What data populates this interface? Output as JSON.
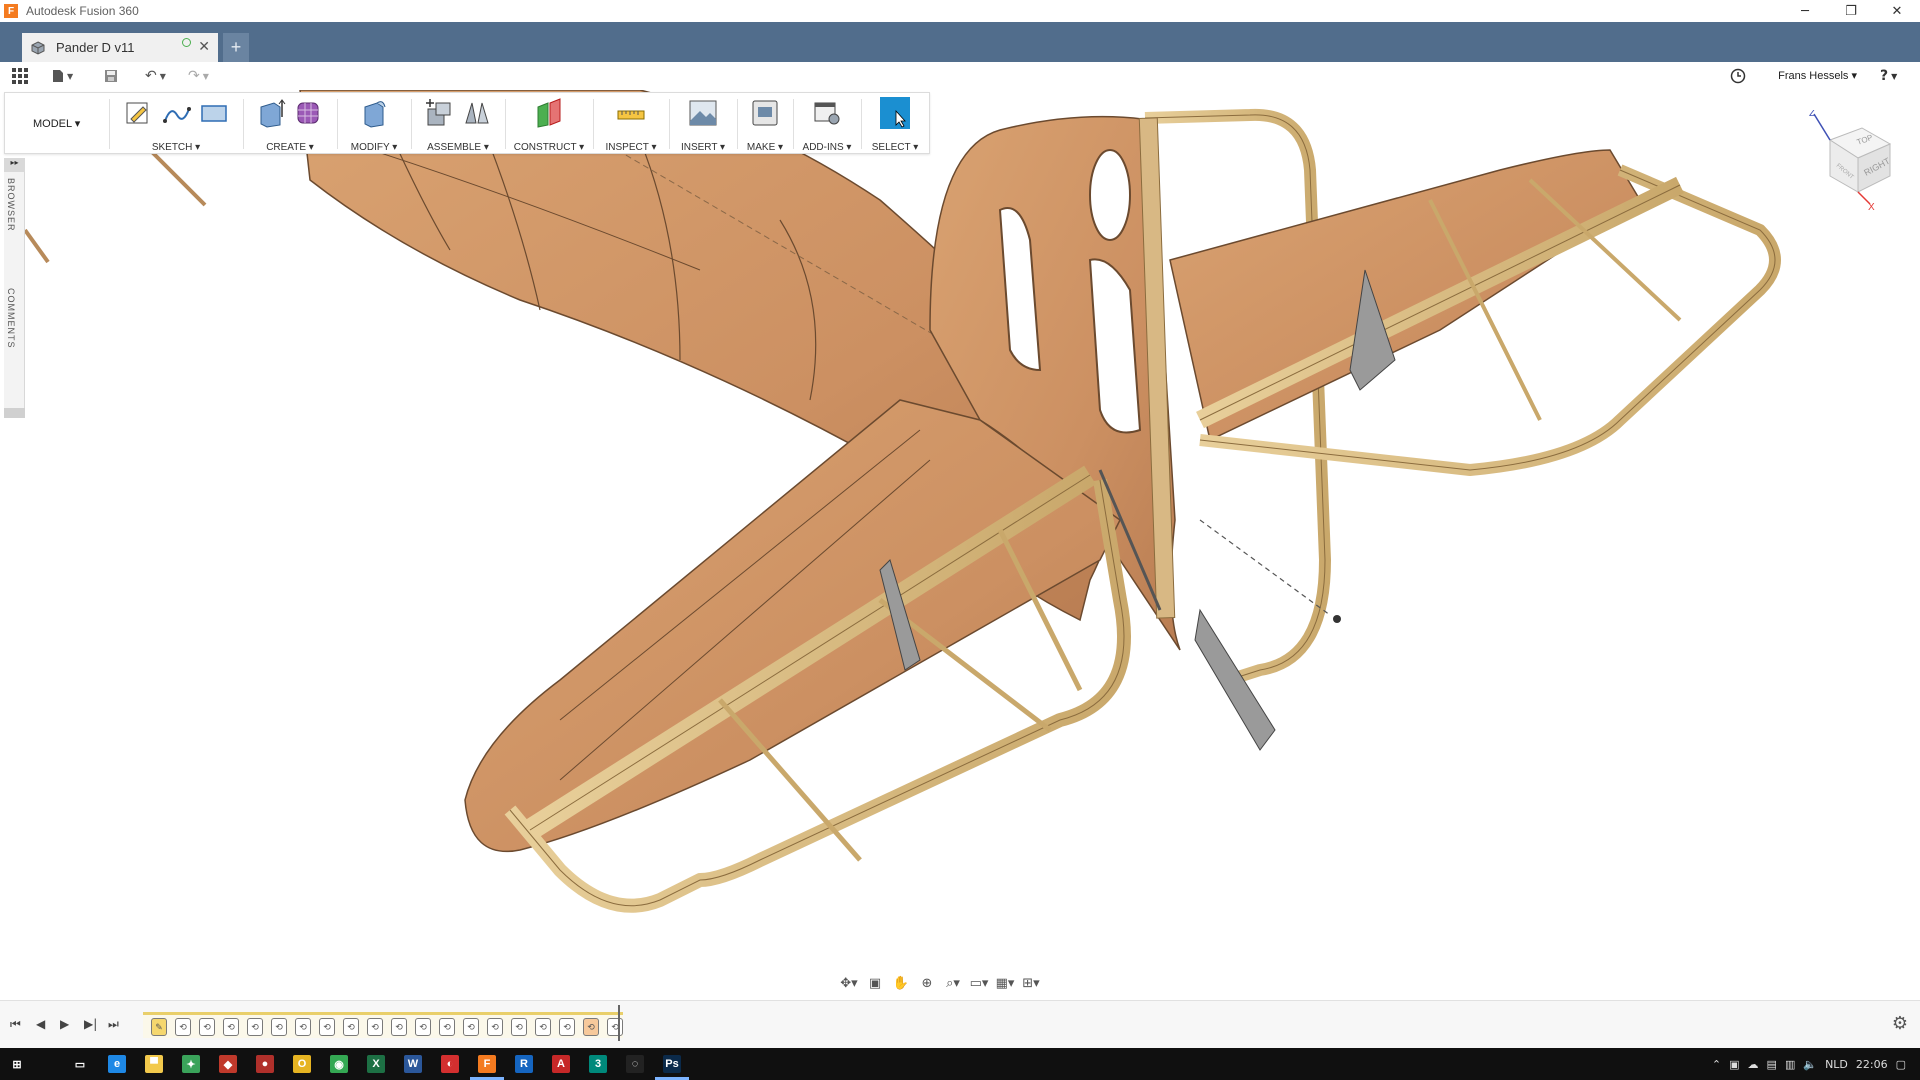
{
  "window": {
    "title": "Autodesk Fusion 360",
    "app_icon_letter": "F",
    "controls": [
      "─",
      "❐",
      "✕"
    ]
  },
  "document_tab": {
    "label": "Pander D v11",
    "close": "✕",
    "new_tab": "+"
  },
  "user": {
    "name": "Frans Hessels ▾",
    "help": "?"
  },
  "toolbar": {
    "workspace": "MODEL ▾",
    "groups": [
      {
        "label": "SKETCH ▾"
      },
      {
        "label": "CREATE ▾"
      },
      {
        "label": "MODIFY ▾"
      },
      {
        "label": "ASSEMBLE ▾"
      },
      {
        "label": "CONSTRUCT ▾"
      },
      {
        "label": "INSPECT ▾"
      },
      {
        "label": "INSERT ▾"
      },
      {
        "label": "MAKE ▾"
      },
      {
        "label": "ADD-INS ▾"
      },
      {
        "label": "SELECT ▾"
      }
    ]
  },
  "side_panel": {
    "collapse": "▸▸",
    "browser": "BROWSER",
    "comments": "COMMENTS"
  },
  "viewcube": {
    "top": "TOP",
    "right": "RIGHT",
    "front": "FRONT",
    "axis_z": "Z",
    "axis_x": "X"
  },
  "timeline": {
    "controls": [
      "⏮",
      "◀",
      "▶",
      "▶|",
      "⏭"
    ],
    "items": 20,
    "gear": "⚙"
  },
  "taskbar": {
    "language": "NLD",
    "time": "22:06",
    "apps": [
      {
        "name": "start",
        "color": "#ffffff",
        "letter": "⊞"
      },
      {
        "name": "task-view",
        "color": "#101010",
        "letter": "▭"
      },
      {
        "name": "edge",
        "color": "#1e88e5",
        "letter": "e"
      },
      {
        "name": "explorer",
        "color": "#f2c94c",
        "letter": "▀"
      },
      {
        "name": "app-green",
        "color": "#3aa35a",
        "letter": "✦"
      },
      {
        "name": "app-red",
        "color": "#c0392b",
        "letter": "◆"
      },
      {
        "name": "app-red2",
        "color": "#b0302b",
        "letter": "●"
      },
      {
        "name": "app-yellow",
        "color": "#e6b422",
        "letter": "O"
      },
      {
        "name": "chrome",
        "color": "#34a853",
        "letter": "◉"
      },
      {
        "name": "excel",
        "color": "#1d7044",
        "letter": "X"
      },
      {
        "name": "word",
        "color": "#2b579a",
        "letter": "W"
      },
      {
        "name": "app-crimson",
        "color": "#d32f2f",
        "letter": "◐"
      },
      {
        "name": "fusion",
        "color": "#f47b20",
        "letter": "F"
      },
      {
        "name": "revit",
        "color": "#1565c0",
        "letter": "R"
      },
      {
        "name": "autocad",
        "color": "#c62828",
        "letter": "A"
      },
      {
        "name": "app-teal",
        "color": "#00897b",
        "letter": "3"
      },
      {
        "name": "app-dark",
        "color": "#222222",
        "letter": "◌"
      },
      {
        "name": "photoshop",
        "color": "#0b2a4a",
        "letter": "Ps"
      }
    ]
  }
}
